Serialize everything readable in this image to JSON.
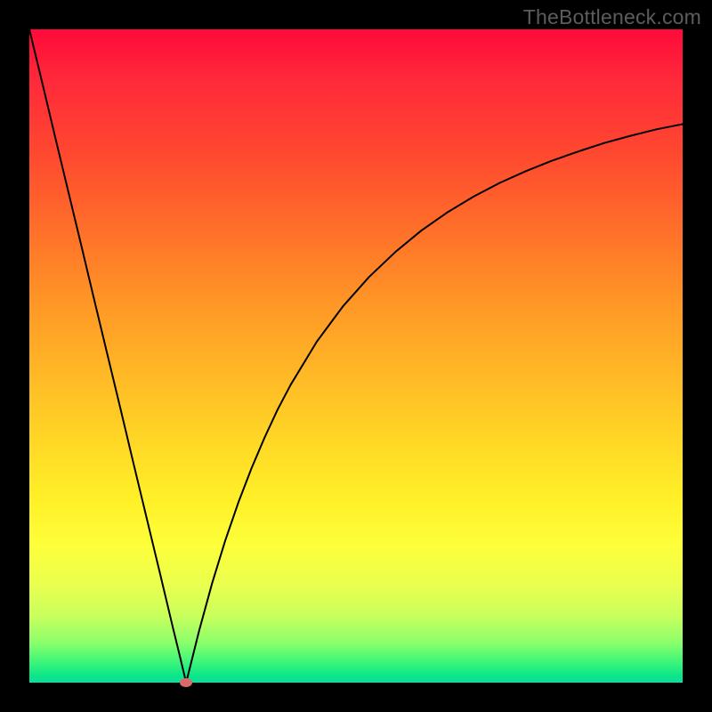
{
  "attribution": "TheBottleneck.com",
  "colors": {
    "frame": "#000000",
    "gradient_top": "#ff0a3a",
    "gradient_bottom": "#0adfa0",
    "curve": "#000000",
    "marker": "#d86a6a"
  },
  "chart_data": {
    "type": "line",
    "title": "",
    "xlabel": "",
    "ylabel": "",
    "xlim": [
      0,
      100
    ],
    "ylim": [
      0,
      100
    ],
    "marker": {
      "x": 24,
      "y": 0
    },
    "x": [
      0,
      2,
      4,
      6,
      8,
      10,
      12,
      14,
      16,
      18,
      20,
      22,
      23,
      24,
      25,
      26,
      28,
      30,
      32,
      34,
      36,
      38,
      40,
      44,
      48,
      52,
      56,
      60,
      64,
      68,
      72,
      76,
      80,
      84,
      88,
      92,
      96,
      100
    ],
    "values": [
      100,
      91.7,
      83.3,
      75.0,
      66.7,
      58.3,
      50.0,
      41.7,
      33.3,
      25.0,
      16.7,
      8.3,
      4.2,
      0,
      4.0,
      8.0,
      15.3,
      21.8,
      27.6,
      32.8,
      37.5,
      41.8,
      45.6,
      52.2,
      57.6,
      62.1,
      65.9,
      69.2,
      72.0,
      74.4,
      76.5,
      78.3,
      79.9,
      81.3,
      82.6,
      83.7,
      84.7,
      85.5
    ]
  }
}
